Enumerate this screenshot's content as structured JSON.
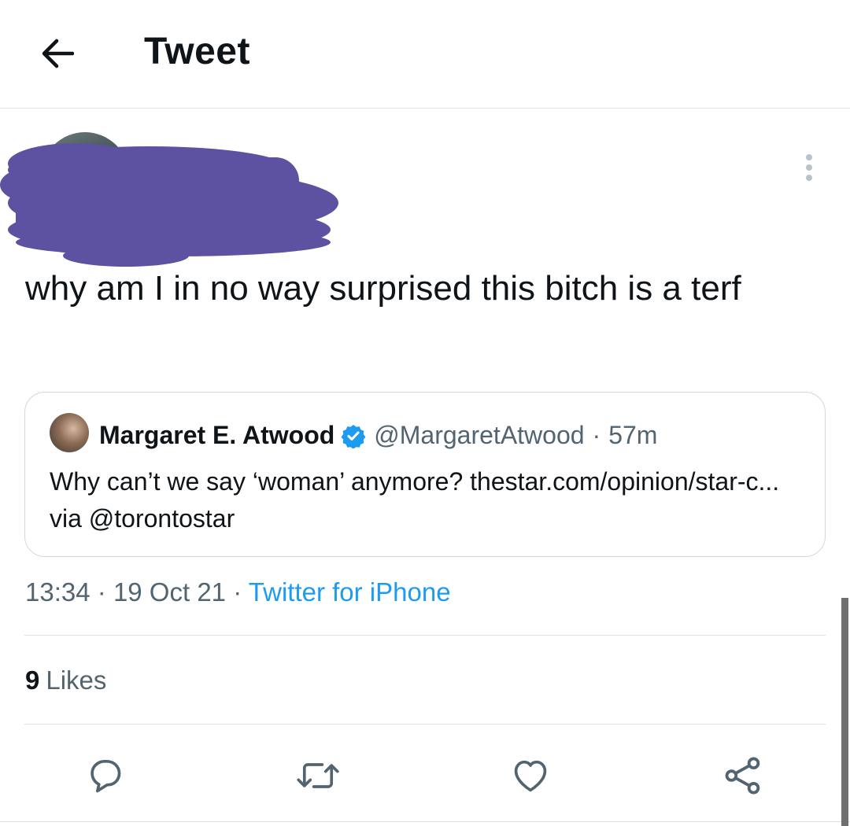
{
  "header": {
    "back_icon": "arrow-left-icon",
    "title": "Tweet"
  },
  "author": {
    "name_redacted": true,
    "redaction_color": "#5c52a1"
  },
  "tweet": {
    "text": "why am I in no way surprised this bitch is a terf"
  },
  "quoted_tweet": {
    "name": "Margaret E. Atwood",
    "verified": true,
    "handle": "@MargaretAtwood",
    "separator": "·",
    "time": "57m",
    "text": "Why can’t we say ‘woman’ anymore? thestar.com/opinion/star-c... via @torontostar"
  },
  "meta": {
    "time": "13:34",
    "sep1": "·",
    "date": "19 Oct 21",
    "sep2": "·",
    "source": "Twitter for iPhone"
  },
  "likes": {
    "count": "9",
    "label": "Likes"
  },
  "actions": {
    "reply_icon": "reply-icon",
    "retweet_icon": "retweet-icon",
    "like_icon": "heart-icon",
    "share_icon": "share-icon"
  },
  "colors": {
    "link": "#1d9bf0",
    "secondary_text": "#536471",
    "primary_text": "#0f1419",
    "border": "#cfd9de"
  }
}
